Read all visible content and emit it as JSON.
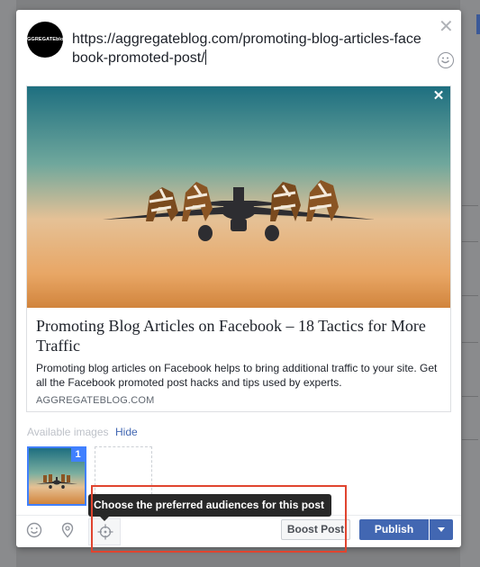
{
  "composer": {
    "avatar_text": "AGGREGATEblog",
    "post_text": "https://aggregateblog.com/promoting-blog-articles-facebook-promoted-post/",
    "close_symbol": "✕"
  },
  "link_preview": {
    "remove_symbol": "✕",
    "title": "Promoting Blog Articles on Facebook – 18 Tactics for More Traffic",
    "description": "Promoting blog articles on Facebook helps to bring additional traffic to your site. Get all the Facebook promoted post hacks and tips used by experts.",
    "domain": "AGGREGATEBLOG.COM"
  },
  "images": {
    "label": "Available images",
    "hide_label": "Hide",
    "selected_badge": "1",
    "add_symbol": "+"
  },
  "tooltip": {
    "text": "Choose the preferred audiences for this post"
  },
  "footer": {
    "tools": [
      "emoji-icon",
      "location-pin-icon",
      "audience-target-icon"
    ],
    "boost_label": "Boost Post",
    "publish_label": "Publish"
  },
  "colors": {
    "brand": "#4267b2",
    "highlight": "#e0442f",
    "tooltip_bg": "#282828"
  }
}
